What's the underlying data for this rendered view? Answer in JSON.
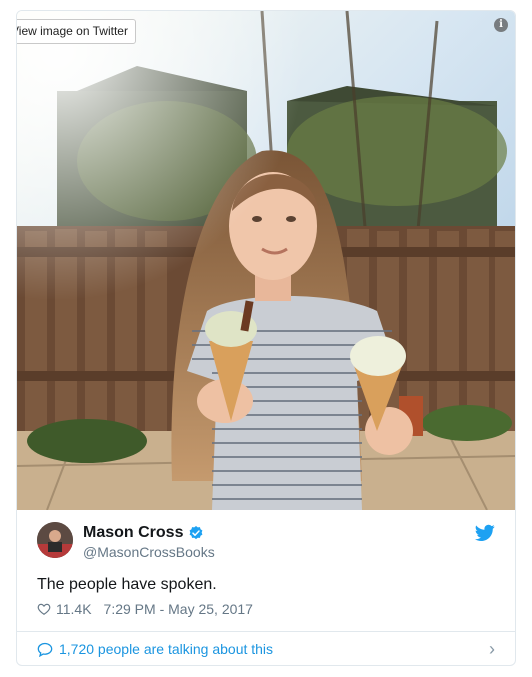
{
  "embed": {
    "view_label": "View image on Twitter",
    "info_icon": "info-icon"
  },
  "tweet": {
    "name": "Mason Cross",
    "handle": "@MasonCrossBooks",
    "text": "The people have spoken.",
    "likes": "11.4K",
    "timestamp": "7:29 PM - May 25, 2017",
    "talking": "1,720 people are talking about this",
    "icons": [
      "verified-badge-icon",
      "twitter-bird-icon",
      "heart-icon",
      "comment-bubble-icon",
      "chevron-right-icon"
    ]
  },
  "colors": {
    "accent": "#1b95e0",
    "secondary_text": "#657786",
    "border": "#e1e8ed"
  }
}
